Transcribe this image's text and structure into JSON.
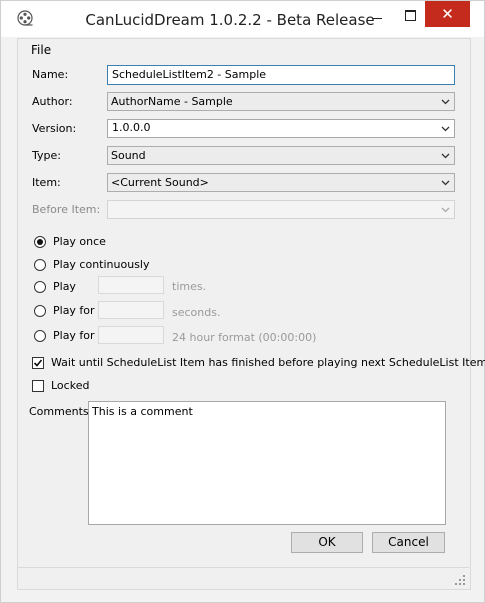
{
  "window": {
    "title": "CanLucidDream 1.0.2.2 - Beta Release",
    "close_glyph": "✕"
  },
  "menu": {
    "file_label": "File"
  },
  "form": {
    "name_label": "Name:",
    "name_value": "ScheduleListItem2 - Sample",
    "author_label": "Author:",
    "author_value": "AuthorName - Sample",
    "version_label": "Version:",
    "version_value": "1.0.0.0",
    "type_label": "Type:",
    "type_value": "Sound",
    "item_label": "Item:",
    "item_value": "<Current Sound>",
    "before_item_label": "Before Item:",
    "before_item_value": ""
  },
  "play_options": {
    "play_once": "Play once",
    "play_continuously": "Play continuously",
    "play": "Play",
    "play_times_hint": "times.",
    "play_for_1": "Play for",
    "seconds_hint": "seconds.",
    "play_for_2": "Play for",
    "format_hint": "24 hour format (00:00:00)"
  },
  "wait_checkbox_label": "Wait until ScheduleList Item has finished before playing next ScheduleList Item",
  "locked_label": "Locked",
  "comments": {
    "label": "Comments:",
    "value": "This is a comment"
  },
  "buttons": {
    "ok": "OK",
    "cancel": "Cancel"
  }
}
